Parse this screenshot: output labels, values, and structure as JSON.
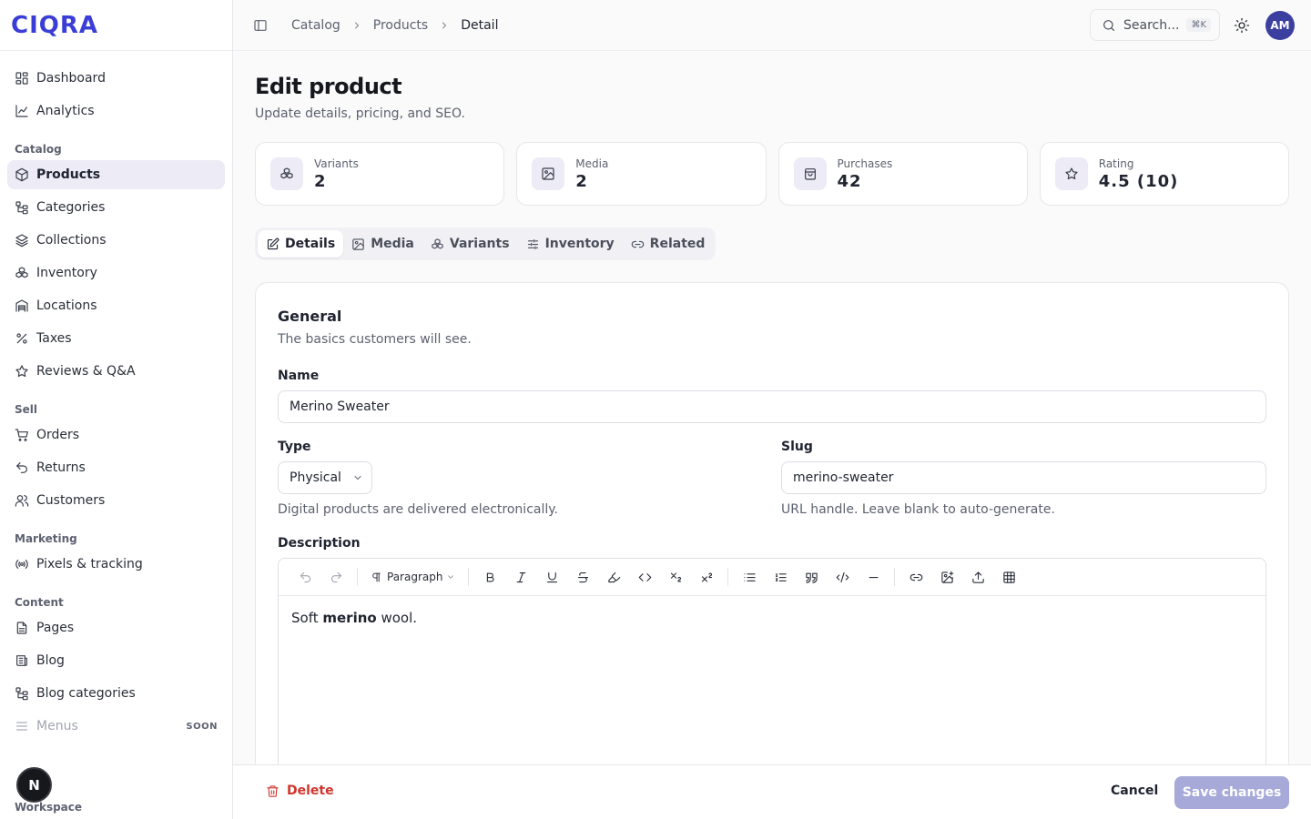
{
  "brand": {
    "logo_text": "CIQRA"
  },
  "sidebar": {
    "top_items": [
      {
        "label": "Dashboard",
        "icon": "dashboard-icon"
      },
      {
        "label": "Analytics",
        "icon": "chart-line-icon"
      }
    ],
    "groups": [
      {
        "label": "Catalog",
        "items": [
          {
            "label": "Products",
            "icon": "package-icon",
            "active": true
          },
          {
            "label": "Categories",
            "icon": "tree-icon"
          },
          {
            "label": "Collections",
            "icon": "layers-icon"
          },
          {
            "label": "Inventory",
            "icon": "boxes-icon"
          },
          {
            "label": "Locations",
            "icon": "warehouse-icon"
          },
          {
            "label": "Taxes",
            "icon": "percent-icon"
          },
          {
            "label": "Reviews & Q&A",
            "icon": "star-icon"
          }
        ]
      },
      {
        "label": "Sell",
        "items": [
          {
            "label": "Orders",
            "icon": "cart-icon"
          },
          {
            "label": "Returns",
            "icon": "undo-icon"
          },
          {
            "label": "Customers",
            "icon": "users-icon"
          }
        ]
      },
      {
        "label": "Marketing",
        "items": [
          {
            "label": "Pixels & tracking",
            "icon": "radio-icon"
          }
        ]
      },
      {
        "label": "Content",
        "items": [
          {
            "label": "Pages",
            "icon": "file-icon"
          },
          {
            "label": "Blog",
            "icon": "newspaper-icon"
          },
          {
            "label": "Blog categories",
            "icon": "tree-icon"
          },
          {
            "label": "Menus",
            "icon": "menu-icon",
            "disabled": true,
            "badge": "SOON"
          }
        ]
      }
    ],
    "workspace_label": "Workspace",
    "fab_letter": "N"
  },
  "topbar": {
    "breadcrumbs": [
      "Catalog",
      "Products",
      "Detail"
    ],
    "search_placeholder": "Search...",
    "search_shortcut": "⌘K",
    "avatar_initials": "AM"
  },
  "page": {
    "title": "Edit product",
    "subtitle": "Update details, pricing, and SEO."
  },
  "stats": [
    {
      "label": "Variants",
      "value": "2",
      "icon": "boxes-icon"
    },
    {
      "label": "Media",
      "value": "2",
      "icon": "image-icon"
    },
    {
      "label": "Purchases",
      "value": "42",
      "icon": "shopping-bag-icon"
    },
    {
      "label": "Rating",
      "value": "4.5 (10)",
      "icon": "star-icon"
    }
  ],
  "tabs": [
    {
      "label": "Details",
      "icon": "edit-icon",
      "active": true
    },
    {
      "label": "Media",
      "icon": "image-icon"
    },
    {
      "label": "Variants",
      "icon": "boxes-icon"
    },
    {
      "label": "Inventory",
      "icon": "sliders-icon"
    },
    {
      "label": "Related",
      "icon": "link-icon"
    }
  ],
  "general": {
    "title": "General",
    "subtitle": "The basics customers will see.",
    "name_label": "Name",
    "name_value": "Merino Sweater",
    "type_label": "Type",
    "type_value": "Physical",
    "type_hint": "Digital products are delivered electronically.",
    "slug_label": "Slug",
    "slug_value": "merino-sweater",
    "slug_hint": "URL handle. Leave blank to auto-generate.",
    "description_label": "Description",
    "paragraph_style": "Paragraph",
    "description_before": "Soft ",
    "description_bold": "merino",
    "description_after": " wool."
  },
  "footer": {
    "delete_label": "Delete",
    "cancel_label": "Cancel",
    "save_label": "Save changes"
  },
  "colors": {
    "brand": "#3b3ed6",
    "accent": "#a7a9d9",
    "danger": "#d0342c"
  }
}
